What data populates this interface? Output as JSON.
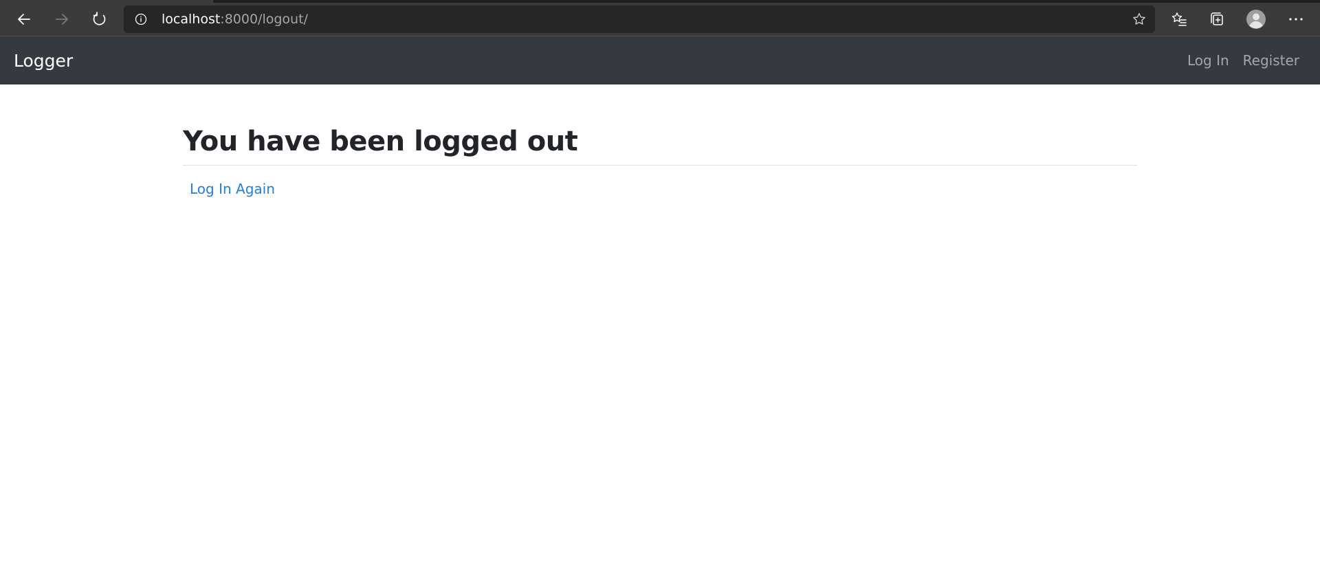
{
  "browser": {
    "url_host": "localhost",
    "url_rest": ":8000/logout/",
    "icons": {
      "back": "arrow-left-icon",
      "forward": "arrow-right-icon",
      "refresh": "refresh-icon",
      "info": "info-icon",
      "favorite": "star-icon",
      "favorites_bar": "favorites-icon",
      "collections": "collections-icon",
      "profile": "profile-icon",
      "more": "more-icon"
    }
  },
  "navbar": {
    "brand": "Logger",
    "links": [
      {
        "label": "Log In"
      },
      {
        "label": "Register"
      }
    ],
    "background_color": "#343a40"
  },
  "main": {
    "title": "You have been logged out",
    "link_label": "Log In Again",
    "link_color": "#1e7fe0"
  }
}
